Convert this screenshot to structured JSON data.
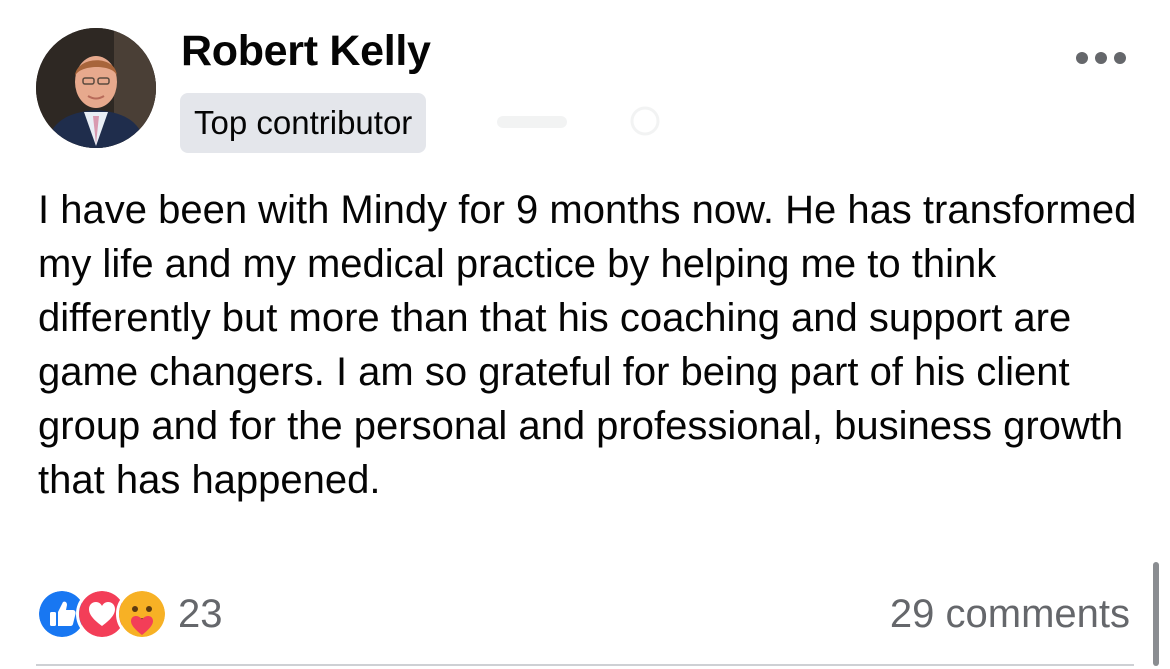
{
  "post": {
    "author": {
      "name": "Robert Kelly",
      "badge": "Top contributor",
      "avatar_icon": "profile-photo"
    },
    "more_icon": "more-horizontal-icon",
    "text": "I have been with Mindy for 9 months now. He has transformed my life and my medical practice by helping me to think differently but more than that his coaching and support are game changers. I am so grateful for being part of his client group and for the personal and professional, business growth that has happened.",
    "reactions": {
      "icons": [
        "like-icon",
        "love-icon",
        "care-icon"
      ],
      "count": "23"
    },
    "comments_label": "29 comments"
  },
  "colors": {
    "like_blue": "#1877f2",
    "love_red": "#f33e58",
    "care_yellow": "#f7b125",
    "secondary_text": "#65676b",
    "badge_bg": "#e4e6eb"
  }
}
